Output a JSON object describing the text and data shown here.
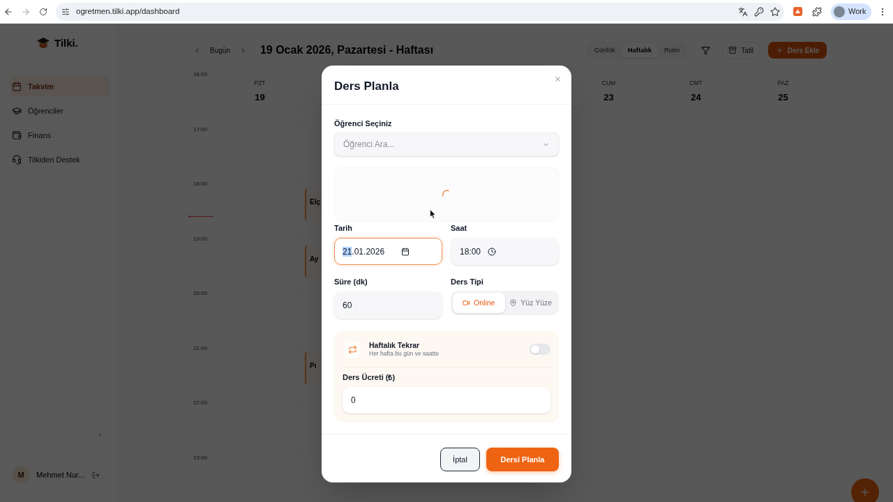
{
  "browser": {
    "url": "ogretmen.tilki.app/dashboard",
    "profile": "Work"
  },
  "sidebar": {
    "logo": "Tilki.",
    "items": [
      {
        "label": "Takvim",
        "selected": true
      },
      {
        "label": "Öğrenciler",
        "selected": false
      },
      {
        "label": "Finans",
        "selected": false
      },
      {
        "label": "Tilkiden Destek",
        "selected": false
      }
    ],
    "user": {
      "initial": "M",
      "name": "Mehmet Nur..."
    }
  },
  "calendar": {
    "today_button": "Bugün",
    "title": "19 Ocak 2026, Pazartesi - Haftası",
    "views": [
      {
        "label": "Günlük",
        "selected": false
      },
      {
        "label": "Haftalık",
        "selected": true
      },
      {
        "label": "Rutin",
        "selected": false
      }
    ],
    "holiday_button": "Tatil",
    "add_button": "Ders Ekle",
    "days": [
      {
        "name": "PZT",
        "date": "19"
      },
      {
        "name": "CUM",
        "date": "23"
      },
      {
        "name": "CMT",
        "date": "24"
      },
      {
        "name": "PAZ",
        "date": "25"
      }
    ],
    "times": [
      "16:00",
      "17:00",
      "18:00",
      "19:00",
      "20:00",
      "21:00",
      "22:00",
      "23:00"
    ],
    "events": [
      {
        "title": "Elç"
      },
      {
        "title": "Ay"
      },
      {
        "title": "Pı"
      }
    ]
  },
  "modal": {
    "title": "Ders Planla",
    "student": {
      "label": "Öğrenci Seçiniz",
      "placeholder": "Öğrenci Ara..."
    },
    "student_panel": {
      "loading": true
    },
    "date": {
      "label": "Tarih",
      "segments": [
        {
          "text": "21",
          "selected": true
        },
        {
          "text": ".01.2026",
          "selected": false
        }
      ],
      "focused": true
    },
    "time": {
      "label": "Saat",
      "value": "18:00",
      "focused": false
    },
    "duration": {
      "label": "Süre (dk)",
      "value": "60"
    },
    "lesson_type": {
      "label": "Ders Tipi",
      "options": [
        {
          "label": "Online",
          "selected": true
        },
        {
          "label": "Yüz Yüze",
          "selected": false
        }
      ]
    },
    "weekly_repeat": {
      "title": "Haftalık Tekrar",
      "subtitle": "Her hafta bu gün ve saatte",
      "on": false
    },
    "fee": {
      "label": "Ders Ücreti (₺)",
      "value": "0"
    },
    "buttons": {
      "cancel": "İptal",
      "submit": "Dersi Planla"
    }
  }
}
